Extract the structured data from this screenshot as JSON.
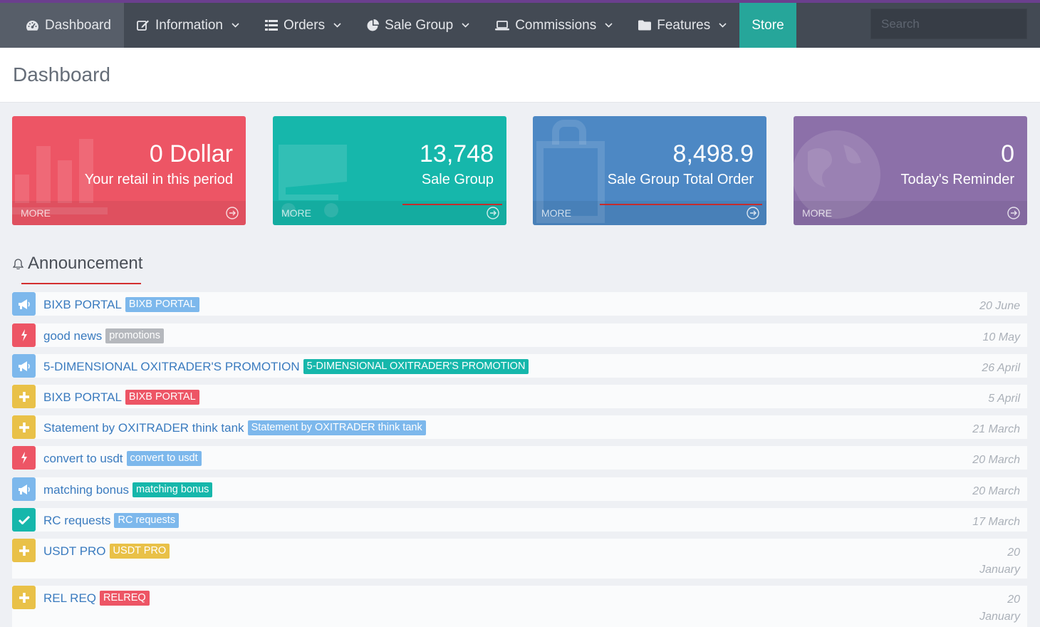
{
  "nav": {
    "items": [
      {
        "label": "Dashboard"
      },
      {
        "label": "Information"
      },
      {
        "label": "Orders"
      },
      {
        "label": "Sale Group"
      },
      {
        "label": "Commissions"
      },
      {
        "label": "Features"
      },
      {
        "label": "Store"
      }
    ],
    "search_placeholder": "Search"
  },
  "page": {
    "title": "Dashboard"
  },
  "cards": [
    {
      "value": "0 Dollar",
      "label": "Your retail in this period",
      "more": "MORE",
      "color": "#ed5565"
    },
    {
      "value": "13,748",
      "label": "Sale Group",
      "more": "MORE",
      "color": "#16b7ab"
    },
    {
      "value": "8,498.9",
      "label": "Sale Group Total Order",
      "more": "MORE",
      "color": "#4d88c4"
    },
    {
      "value": "0",
      "label": "Today's Reminder",
      "more": "MORE",
      "color": "#8c70a9"
    }
  ],
  "announcement": {
    "heading": "Announcement",
    "items": [
      {
        "icon": "megaphone-icon",
        "icon_color": "#7db8ec",
        "title": "BIXB PORTAL",
        "tag": "BIXB PORTAL",
        "tag_color": "#7db8ec",
        "date": "20 June"
      },
      {
        "icon": "bolt-icon",
        "icon_color": "#ed5565",
        "title": "good news",
        "tag": "promotions",
        "tag_color": "#b5b8bd",
        "date": "10 May"
      },
      {
        "icon": "megaphone-icon",
        "icon_color": "#7db8ec",
        "title": "5-DIMENSIONAL OXITRADER'S PROMOTION",
        "tag": "5-DIMENSIONAL OXITRADER'S PROMOTION",
        "tag_color": "#16b7ab",
        "date": "26 April"
      },
      {
        "icon": "plus-icon",
        "icon_color": "#e9c148",
        "title": "BIXB PORTAL",
        "tag": "BIXB PORTAL",
        "tag_color": "#ed5565",
        "date": "5 April"
      },
      {
        "icon": "plus-icon",
        "icon_color": "#e9c148",
        "title": "Statement by OXITRADER think tank",
        "tag": "Statement by OXITRADER think tank",
        "tag_color": "#7db8ec",
        "date": "21 March"
      },
      {
        "icon": "bolt-icon",
        "icon_color": "#ed5565",
        "title": "convert to usdt",
        "tag": "convert to usdt",
        "tag_color": "#7db8ec",
        "date": "20 March"
      },
      {
        "icon": "megaphone-icon",
        "icon_color": "#7db8ec",
        "title": "matching bonus",
        "tag": "matching bonus",
        "tag_color": "#16b7ab",
        "date": "20 March"
      },
      {
        "icon": "check-icon",
        "icon_color": "#16b7ab",
        "title": "RC requests",
        "tag": "RC requests",
        "tag_color": "#7db8ec",
        "date": "17 March"
      },
      {
        "icon": "plus-icon",
        "icon_color": "#e9c148",
        "title": "USDT PRO",
        "tag": "USDT PRO",
        "tag_color": "#e9c148",
        "date_line1": "20",
        "date_line2": "January"
      },
      {
        "icon": "plus-icon",
        "icon_color": "#e9c148",
        "title": "REL REQ",
        "tag": "RELREQ",
        "tag_color": "#ed5565",
        "date_line1": "20",
        "date_line2": "January"
      }
    ]
  }
}
